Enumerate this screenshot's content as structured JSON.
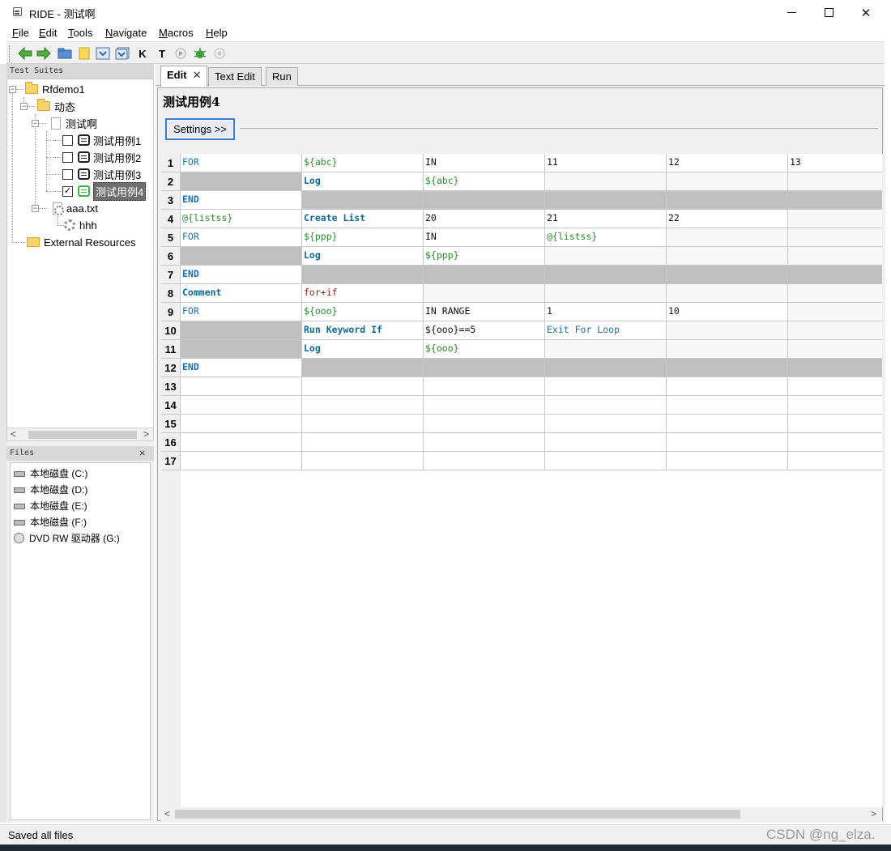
{
  "window": {
    "title": "RIDE - 测试啊",
    "controls": {
      "minimize": "",
      "maximize": "",
      "close": "✕"
    }
  },
  "menu": {
    "items": [
      {
        "key": "F",
        "rest": "ile"
      },
      {
        "key": "E",
        "rest": "dit"
      },
      {
        "key": "T",
        "rest": "ools"
      },
      {
        "key": "N",
        "rest": "avigate"
      },
      {
        "key": "M",
        "rest": "acros"
      },
      {
        "key": "H",
        "rest": "elp"
      }
    ]
  },
  "toolbar": {
    "icons": [
      "back-arrow-icon",
      "forward-arrow-icon",
      "open-folder-icon",
      "new-file-icon",
      "save-icon",
      "save-all-icon",
      "search-keyword-icon",
      "search-tests-icon",
      "run-icon",
      "debug-icon",
      "stop-icon"
    ],
    "k_label": "K",
    "t_label": "T"
  },
  "test_suites": {
    "header": "Test Suites",
    "nodes": {
      "root": "Rfdemo1",
      "folder": "动态",
      "suite": "测试啊",
      "tc1": "测试用例1",
      "tc2": "测试用例2",
      "tc3": "测试用例3",
      "tc4": "测试用例4",
      "resource": "aaa.txt",
      "keyword": "hhh",
      "external": "External Resources"
    },
    "checked": {
      "tc1": false,
      "tc2": false,
      "tc3": false,
      "tc4": true
    },
    "selected": "测试用例4"
  },
  "files": {
    "header": "Files",
    "close": "✕",
    "drives": [
      "本地磁盘 (C:)",
      "本地磁盘 (D:)",
      "本地磁盘 (E:)",
      "本地磁盘 (F:)",
      "DVD RW 驱动器 (G:)"
    ]
  },
  "editor": {
    "tabs": {
      "edit": "Edit",
      "text_edit": "Text Edit",
      "run": "Run",
      "close": "✕"
    },
    "active_tab": "Edit",
    "testcase_title": "测试用例4",
    "settings_button": "Settings >>",
    "grid": {
      "row_numbers": [
        "1",
        "2",
        "3",
        "4",
        "5",
        "6",
        "7",
        "8",
        "9",
        "10",
        "11",
        "12",
        "13",
        "14",
        "15",
        "16",
        "17"
      ],
      "rows": [
        [
          "FOR",
          "${abc}",
          "IN",
          "11",
          "12",
          "13"
        ],
        [
          "",
          "Log",
          "${abc}",
          "",
          "",
          ""
        ],
        [
          "END",
          "",
          "",
          "",
          "",
          ""
        ],
        [
          "@{listss}",
          "Create List",
          "20",
          "21",
          "22",
          ""
        ],
        [
          "FOR",
          "${ppp}",
          "IN",
          "@{listss}",
          "",
          ""
        ],
        [
          "",
          "Log",
          "${ppp}",
          "",
          "",
          ""
        ],
        [
          "END",
          "",
          "",
          "",
          "",
          ""
        ],
        [
          "Comment",
          "for+if",
          "",
          "",
          "",
          ""
        ],
        [
          "FOR",
          "${ooo}",
          "IN RANGE",
          "1",
          "10",
          ""
        ],
        [
          "",
          "Run Keyword If",
          "${ooo}==5",
          "Exit For Loop",
          "",
          ""
        ],
        [
          "",
          "Log",
          "${ooo}",
          "",
          "",
          ""
        ],
        [
          "END",
          "",
          "",
          "",
          "",
          ""
        ],
        [
          "",
          "",
          "",
          "",
          "",
          ""
        ],
        [
          "",
          "",
          "",
          "",
          "",
          ""
        ],
        [
          "",
          "",
          "",
          "",
          "",
          ""
        ],
        [
          "",
          "",
          "",
          "",
          "",
          ""
        ],
        [
          "",
          "",
          "",
          "",
          "",
          ""
        ]
      ]
    }
  },
  "status": {
    "text": "Saved all files",
    "watermark": "CSDN @ng_elza."
  }
}
